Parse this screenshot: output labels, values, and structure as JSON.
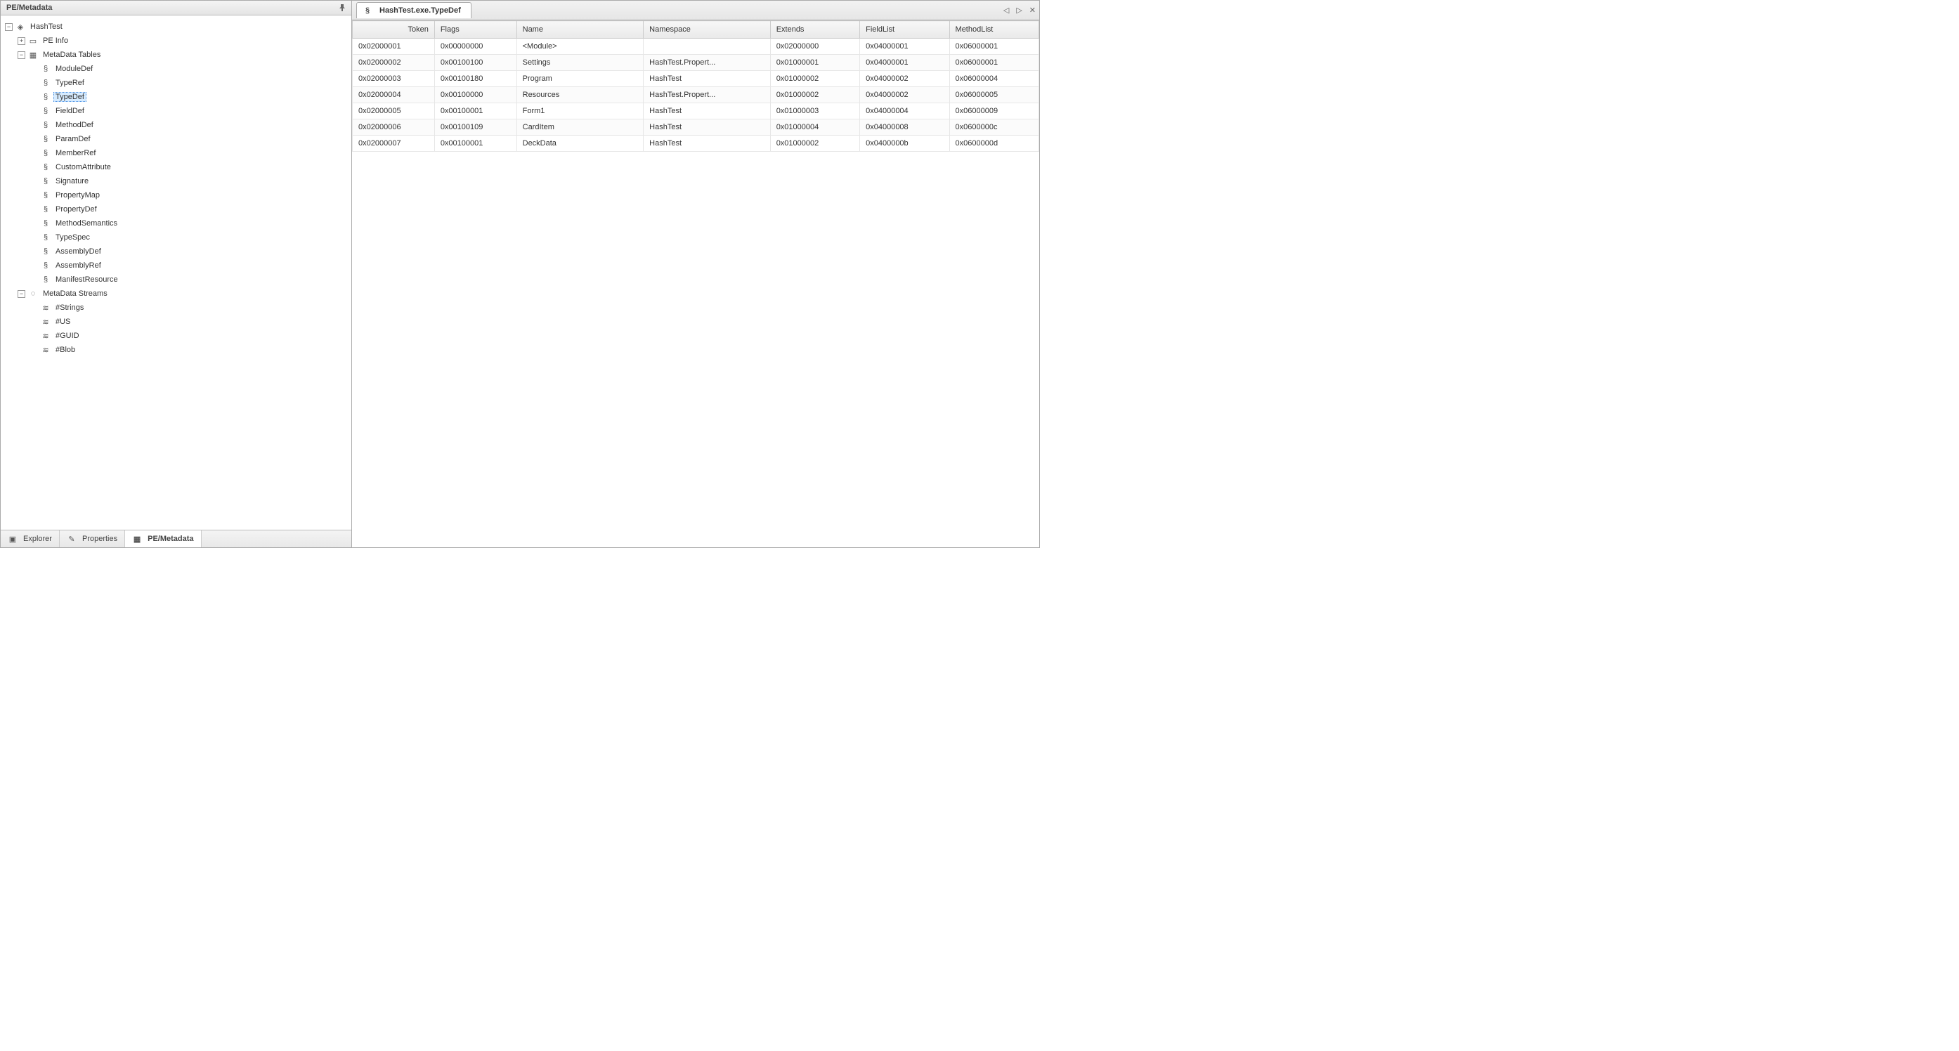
{
  "sidebar": {
    "title": "PE/Metadata",
    "tree": {
      "root": {
        "label": "HashTest",
        "children": [
          {
            "label": "PE Info"
          },
          {
            "label": "MetaData Tables",
            "children": [
              "ModuleDef",
              "TypeRef",
              "TypeDef",
              "FieldDef",
              "MethodDef",
              "ParamDef",
              "MemberRef",
              "CustomAttribute",
              "Signature",
              "PropertyMap",
              "PropertyDef",
              "MethodSemantics",
              "TypeSpec",
              "AssemblyDef",
              "AssemblyRef",
              "ManifestResource"
            ],
            "selected": "TypeDef"
          },
          {
            "label": "MetaData Streams",
            "children": [
              "#Strings",
              "#US",
              "#GUID",
              "#Blob"
            ]
          }
        ]
      }
    },
    "bottomTabs": [
      {
        "label": "Explorer"
      },
      {
        "label": "Properties"
      },
      {
        "label": "PE/Metadata",
        "active": true
      }
    ]
  },
  "main": {
    "tab": {
      "label": "HashTest.exe.TypeDef"
    },
    "columns": [
      "Token",
      "Flags",
      "Name",
      "Namespace",
      "Extends",
      "FieldList",
      "MethodList"
    ],
    "rows": [
      {
        "token": "0x02000001",
        "flags": "0x00000000",
        "name": "<Module>",
        "ns": "",
        "ext": "0x02000000",
        "fl": "0x04000001",
        "ml": "0x06000001"
      },
      {
        "token": "0x02000002",
        "flags": "0x00100100",
        "name": "Settings",
        "ns": "HashTest.Propert...",
        "ext": "0x01000001",
        "fl": "0x04000001",
        "ml": "0x06000001"
      },
      {
        "token": "0x02000003",
        "flags": "0x00100180",
        "name": "Program",
        "ns": "HashTest",
        "ext": "0x01000002",
        "fl": "0x04000002",
        "ml": "0x06000004"
      },
      {
        "token": "0x02000004",
        "flags": "0x00100000",
        "name": "Resources",
        "ns": "HashTest.Propert...",
        "ext": "0x01000002",
        "fl": "0x04000002",
        "ml": "0x06000005"
      },
      {
        "token": "0x02000005",
        "flags": "0x00100001",
        "name": "Form1",
        "ns": "HashTest",
        "ext": "0x01000003",
        "fl": "0x04000004",
        "ml": "0x06000009"
      },
      {
        "token": "0x02000006",
        "flags": "0x00100109",
        "name": "CardItem",
        "ns": "HashTest",
        "ext": "0x01000004",
        "fl": "0x04000008",
        "ml": "0x0600000c"
      },
      {
        "token": "0x02000007",
        "flags": "0x00100001",
        "name": "DeckData",
        "ns": "HashTest",
        "ext": "0x01000002",
        "fl": "0x0400000b",
        "ml": "0x0600000d"
      }
    ]
  }
}
